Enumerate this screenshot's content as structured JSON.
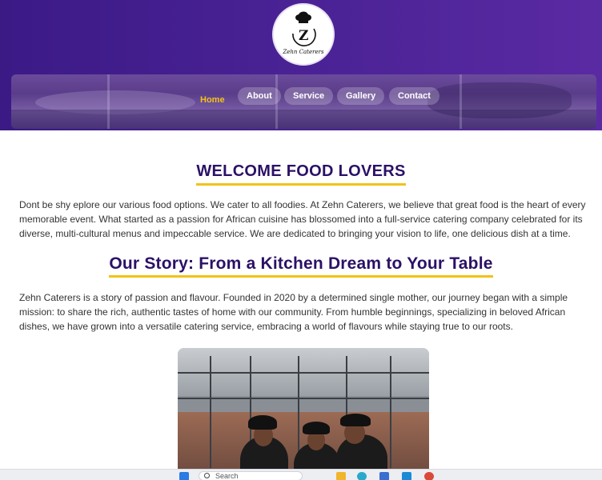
{
  "header": {
    "logo_text": "Zehn Caterers"
  },
  "nav": {
    "items": [
      {
        "label": "Home",
        "active": true
      },
      {
        "label": "About",
        "active": false
      },
      {
        "label": "Service",
        "active": false
      },
      {
        "label": "Gallery",
        "active": false
      },
      {
        "label": "Contact",
        "active": false
      }
    ]
  },
  "main": {
    "welcome_title": "WELCOME FOOD LOVERS",
    "welcome_text": "Dont be shy eplore our various food options. We cater to all foodies. At Zehn Caterers, we believe that great food is the heart of every memorable event. What started as a passion for African cuisine has blossomed into a full-service catering company celebrated for its diverse, multi-cultural menus and impeccable service. We are dedicated to bringing your vision to life, one delicious dish at a time.",
    "story_title": "Our Story: From a Kitchen Dream to Your Table",
    "story_text": "Zehn Caterers is a story of passion and flavour. Founded in 2020 by a determined single mother, our journey began with a simple mission: to share the rich, authentic tastes of home with our community. From humble beginnings, specializing in beloved African dishes, we have grown into a versatile catering service, embracing a world of flavours while staying true to our roots."
  },
  "taskbar": {
    "search_placeholder": "Search",
    "icons": [
      "windows-icon",
      "folder-icon",
      "edge-icon",
      "store-icon",
      "vscode-icon",
      "chrome-icon"
    ]
  },
  "colors": {
    "header_purple": "#4a2295",
    "heading_navy": "#2b1166",
    "accent_gold": "#f2c318"
  }
}
